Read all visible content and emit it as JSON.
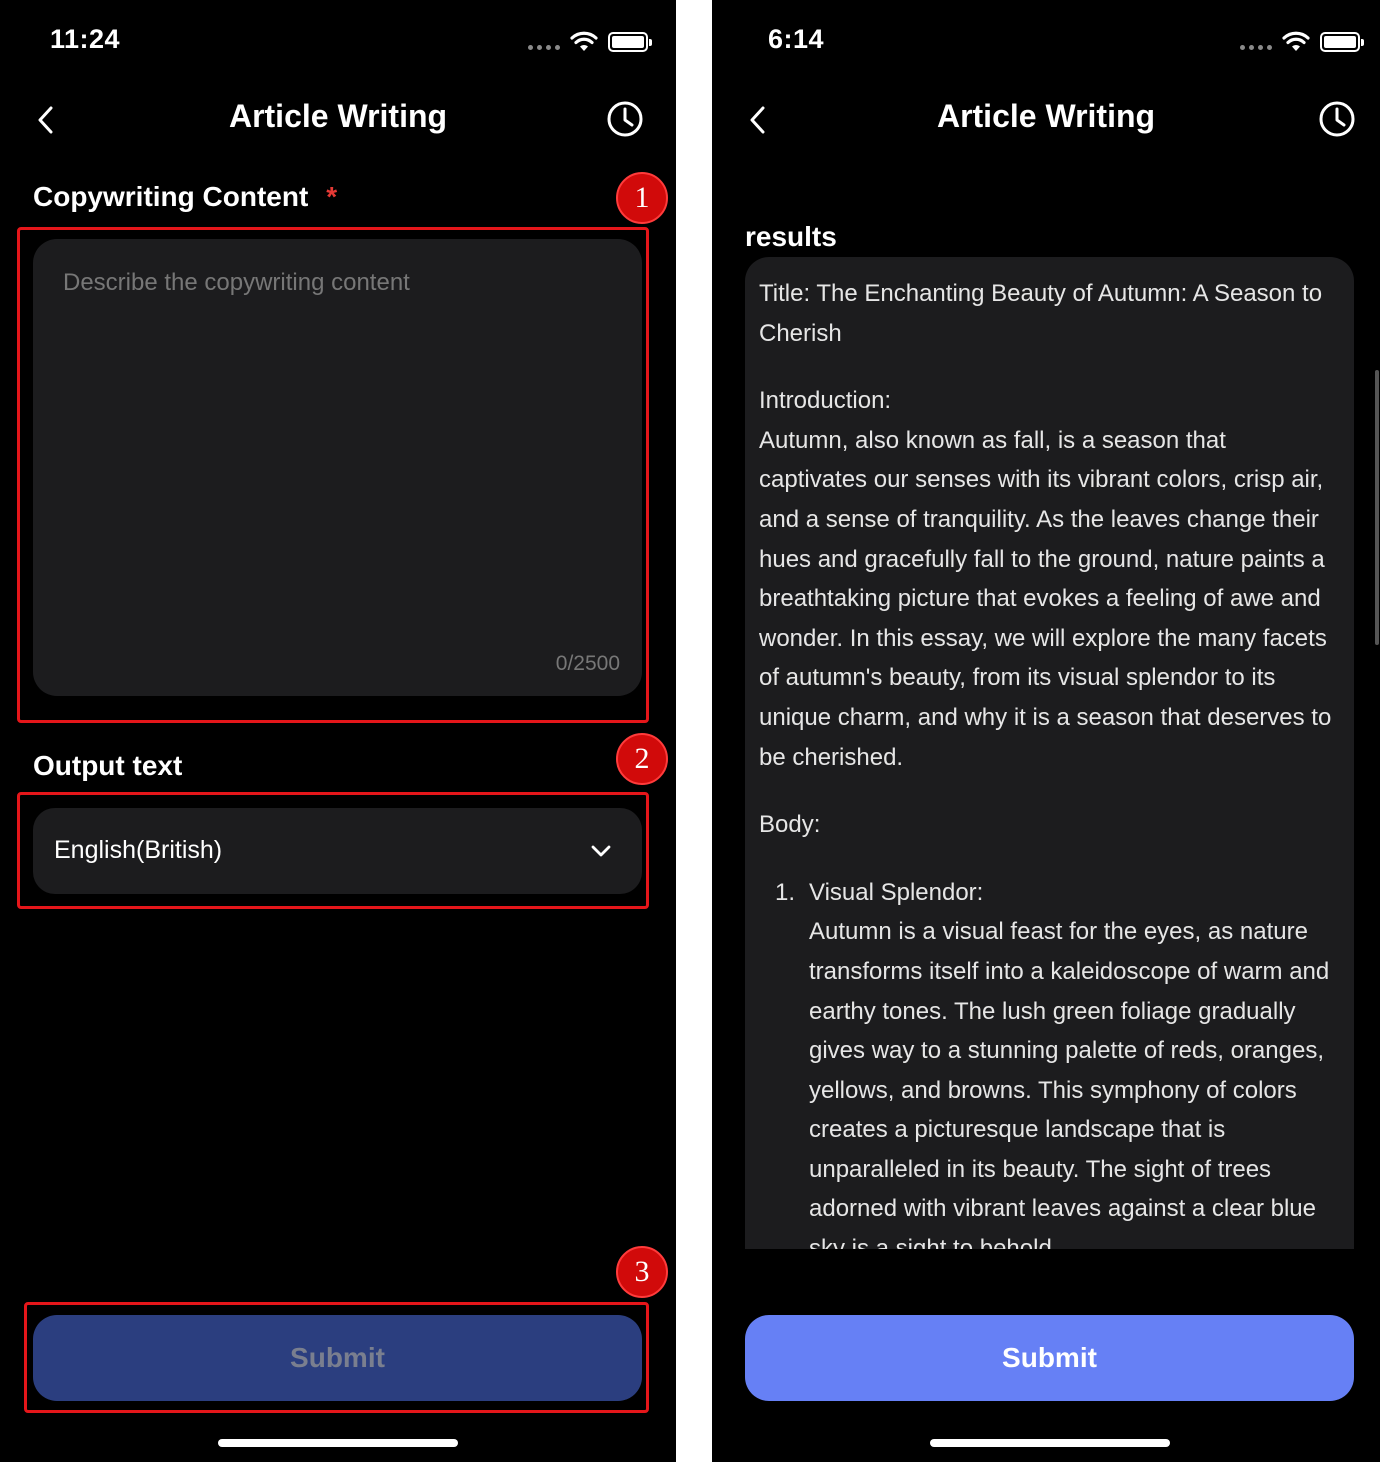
{
  "left": {
    "status": {
      "time": "11:24"
    },
    "nav": {
      "title": "Article Writing"
    },
    "copy_section": {
      "label": "Copywriting Content",
      "required_mark": "*",
      "placeholder": "Describe the copywriting content",
      "counter": "0/2500"
    },
    "output_section": {
      "label": "Output text",
      "selected": "English(British)"
    },
    "submit_label": "Submit",
    "callouts": [
      "1",
      "2",
      "3"
    ]
  },
  "right": {
    "status": {
      "time": "6:14"
    },
    "nav": {
      "title": "Article Writing"
    },
    "results_label": "results",
    "results": {
      "title": "Title: The Enchanting Beauty of Autumn: A Season to Cherish",
      "intro_heading": "Introduction:",
      "intro_text": "Autumn, also known as fall, is a season that captivates our senses with its vibrant colors, crisp air, and a sense of tranquility. As the leaves change their hues and gracefully fall to the ground, nature paints a breathtaking picture that evokes a feeling of awe and wonder. In this essay, we will explore the many facets of autumn's beauty, from its visual splendor to its unique charm, and why it is a season that deserves to be cherished.",
      "body_heading": "Body:",
      "list_item_number": "1.",
      "list_item_heading": "Visual Splendor:",
      "list_item_text": "Autumn is a visual feast for the eyes, as nature transforms itself into a kaleidoscope of warm and earthy tones. The lush green foliage gradually gives way to a stunning palette of reds, oranges, yellows, and browns. This symphony of colors creates a picturesque landscape that is unparalleled in its beauty. The sight of trees adorned with vibrant leaves against a clear blue sky is a sight to behold"
    },
    "submit_label": "Submit"
  },
  "colors": {
    "background": "#000000",
    "card": "#1c1c1e",
    "accent": "#6680f5",
    "disabled_button": "#2b3e7f",
    "callout_red": "#e5161a"
  }
}
